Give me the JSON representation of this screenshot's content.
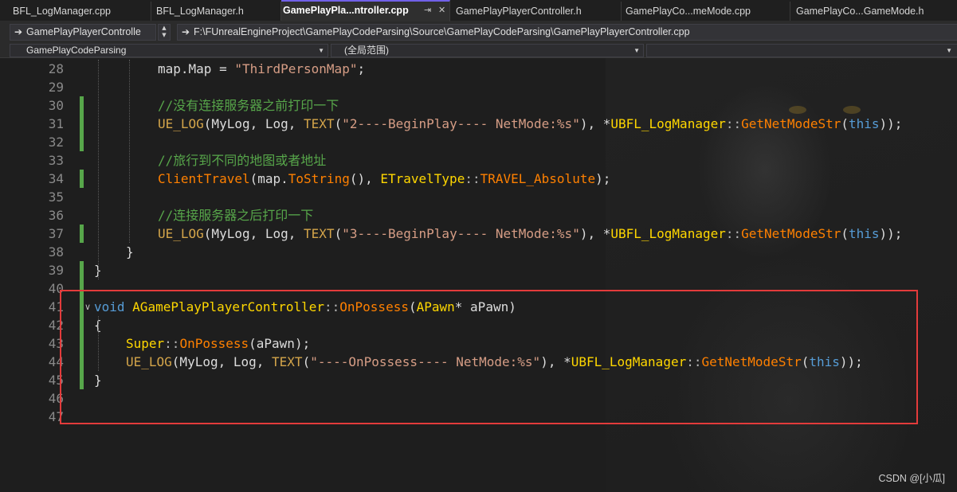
{
  "tabs": [
    {
      "label": "BFL_LogManager.cpp",
      "active": false
    },
    {
      "label": "BFL_LogManager.h",
      "active": false
    },
    {
      "label": "GamePlayPla...ntroller.cpp",
      "active": true
    },
    {
      "label": "GamePlayPlayerController.h",
      "active": false
    },
    {
      "label": "GamePlayCo...meMode.cpp",
      "active": false
    },
    {
      "label": "GamePlayCo...GameMode.h",
      "active": false
    }
  ],
  "nav": {
    "class_dropdown": "GamePlayPlayerControlle",
    "file_path": "F:\\FUnrealEngineProject\\GamePlayCodeParsing\\Source\\GamePlayCodeParsing\\GamePlayPlayerController.cpp",
    "project_dropdown": "GamePlayCodeParsing",
    "scope_dropdown": "(全局范围)"
  },
  "icons": {
    "tab_pin": "pin-icon",
    "nav_arrow": "arrow-right-icon",
    "spinner": "spinner-icon",
    "dropdown_caret": "caret-down-icon",
    "fold": "collapse-icon"
  },
  "editor": {
    "line_numbers": [
      "28",
      "29",
      "30",
      "31",
      "32",
      "33",
      "34",
      "35",
      "36",
      "37",
      "38",
      "39",
      "40",
      "41",
      "42",
      "43",
      "44",
      "45",
      "46",
      "47"
    ],
    "lines": [
      {
        "num": "28",
        "indent": 2,
        "tokens": [
          [
            "",
            "map.Map = "
          ],
          [
            "str",
            "\"ThirdPersonMap\""
          ],
          [
            "",
            ";"
          ]
        ]
      },
      {
        "num": "29",
        "indent": 0,
        "tokens": []
      },
      {
        "num": "30",
        "indent": 2,
        "tokens": [
          [
            "cm",
            "//没有连接服务器之前打印一下"
          ]
        ]
      },
      {
        "num": "31",
        "indent": 2,
        "tokens": [
          [
            "mac",
            "UE_LOG"
          ],
          [
            "",
            "(MyLog, Log, "
          ],
          [
            "mac",
            "TEXT"
          ],
          [
            "",
            "("
          ],
          [
            "str",
            "\"2----BeginPlay---- NetMode:%s\""
          ],
          [
            "",
            "), *"
          ],
          [
            "cls",
            "UBFL_LogManager"
          ],
          [
            "op",
            "::"
          ],
          [
            "fn",
            "GetNetModeStr"
          ],
          [
            "",
            "("
          ],
          [
            "kw",
            "this"
          ],
          [
            "",
            "));"
          ]
        ]
      },
      {
        "num": "32",
        "indent": 0,
        "tokens": []
      },
      {
        "num": "33",
        "indent": 2,
        "tokens": [
          [
            "cm",
            "//旅行到不同的地图或者地址"
          ]
        ]
      },
      {
        "num": "34",
        "indent": 2,
        "tokens": [
          [
            "fn",
            "ClientTravel"
          ],
          [
            "",
            "(map."
          ],
          [
            "fn",
            "ToString"
          ],
          [
            "",
            "(), "
          ],
          [
            "cls",
            "ETravelType"
          ],
          [
            "op",
            "::"
          ],
          [
            "en",
            "TRAVEL_Absolute"
          ],
          [
            "",
            ");"
          ]
        ]
      },
      {
        "num": "35",
        "indent": 0,
        "tokens": []
      },
      {
        "num": "36",
        "indent": 2,
        "tokens": [
          [
            "cm",
            "//连接服务器之后打印一下"
          ]
        ]
      },
      {
        "num": "37",
        "indent": 2,
        "tokens": [
          [
            "mac",
            "UE_LOG"
          ],
          [
            "",
            "(MyLog, Log, "
          ],
          [
            "mac",
            "TEXT"
          ],
          [
            "",
            "("
          ],
          [
            "str",
            "\"3----BeginPlay---- NetMode:%s\""
          ],
          [
            "",
            "), *"
          ],
          [
            "cls",
            "UBFL_LogManager"
          ],
          [
            "op",
            "::"
          ],
          [
            "fn",
            "GetNetModeStr"
          ],
          [
            "",
            "("
          ],
          [
            "kw",
            "this"
          ],
          [
            "",
            "));"
          ]
        ]
      },
      {
        "num": "38",
        "indent": 1,
        "tokens": [
          [
            "",
            "}"
          ]
        ]
      },
      {
        "num": "39",
        "indent": 0,
        "tokens": [
          [
            "",
            "}"
          ]
        ]
      },
      {
        "num": "40",
        "indent": 0,
        "tokens": []
      },
      {
        "num": "41",
        "indent": 0,
        "tokens": [
          [
            "kw",
            "void"
          ],
          [
            "",
            " "
          ],
          [
            "cls",
            "AGamePlayPlayerController"
          ],
          [
            "op",
            "::"
          ],
          [
            "fn",
            "OnPossess"
          ],
          [
            "",
            "("
          ],
          [
            "cls",
            "APawn"
          ],
          [
            "",
            "* aPawn)"
          ]
        ]
      },
      {
        "num": "42",
        "indent": 0,
        "tokens": [
          [
            "",
            "{"
          ]
        ]
      },
      {
        "num": "43",
        "indent": 1,
        "tokens": [
          [
            "cls",
            "Super"
          ],
          [
            "op",
            "::"
          ],
          [
            "fn",
            "OnPossess"
          ],
          [
            "",
            "(aPawn);"
          ]
        ]
      },
      {
        "num": "44",
        "indent": 1,
        "tokens": [
          [
            "mac",
            "UE_LOG"
          ],
          [
            "",
            "(MyLog, Log, "
          ],
          [
            "mac",
            "TEXT"
          ],
          [
            "",
            "("
          ],
          [
            "str",
            "\"----OnPossess---- NetMode:%s\""
          ],
          [
            "",
            "), *"
          ],
          [
            "cls",
            "UBFL_LogManager"
          ],
          [
            "op",
            "::"
          ],
          [
            "fn",
            "GetNetModeStr"
          ],
          [
            "",
            "("
          ],
          [
            "kw",
            "this"
          ],
          [
            "",
            "));"
          ]
        ]
      },
      {
        "num": "45",
        "indent": 0,
        "tokens": [
          [
            "",
            "}"
          ]
        ]
      },
      {
        "num": "46",
        "indent": 0,
        "tokens": []
      },
      {
        "num": "47",
        "indent": 0,
        "tokens": []
      }
    ]
  },
  "watermark": "CSDN @[小瓜]",
  "colors": {
    "background": "#1e1e1e",
    "keyword": "#569cd6",
    "type": "#ffd700",
    "function": "#ff8000",
    "string": "#d69d85",
    "comment": "#57a64a",
    "change_bar": "#57a64a",
    "highlight_border": "#e33b3b",
    "active_tab_accent": "#7160e8"
  }
}
